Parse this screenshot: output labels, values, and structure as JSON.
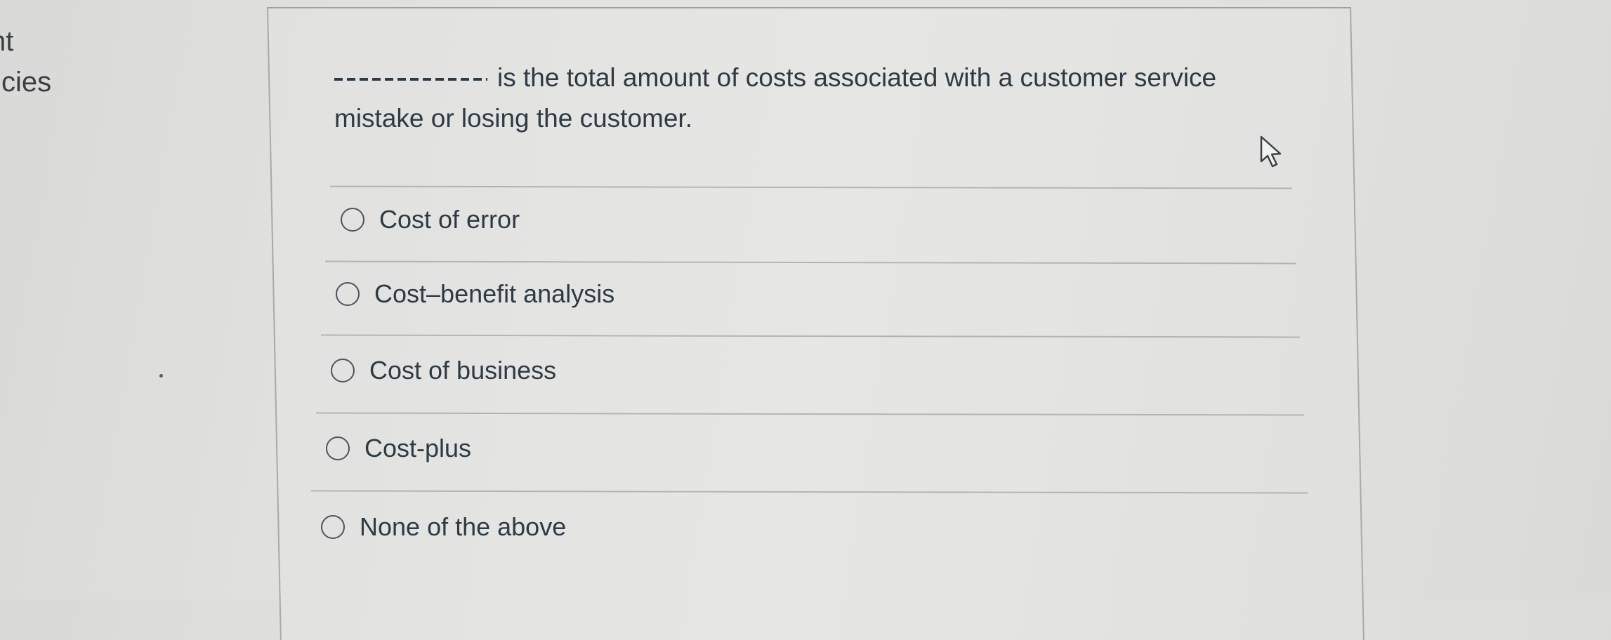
{
  "sidebar": {
    "fragment_line1": "nt",
    "fragment_line2": "cies"
  },
  "question": {
    "blank_label": "___________",
    "text_after_blank": "is the total amount of costs associated with a customer service mistake or losing the customer."
  },
  "answers": [
    {
      "label": "Cost of error",
      "selected": false
    },
    {
      "label": "Cost–benefit analysis",
      "selected": false
    },
    {
      "label": "Cost of business",
      "selected": false
    },
    {
      "label": "Cost-plus",
      "selected": false
    },
    {
      "label": "None of the above",
      "selected": false
    }
  ],
  "cursor": {
    "icon": "mouse-pointer-icon"
  }
}
